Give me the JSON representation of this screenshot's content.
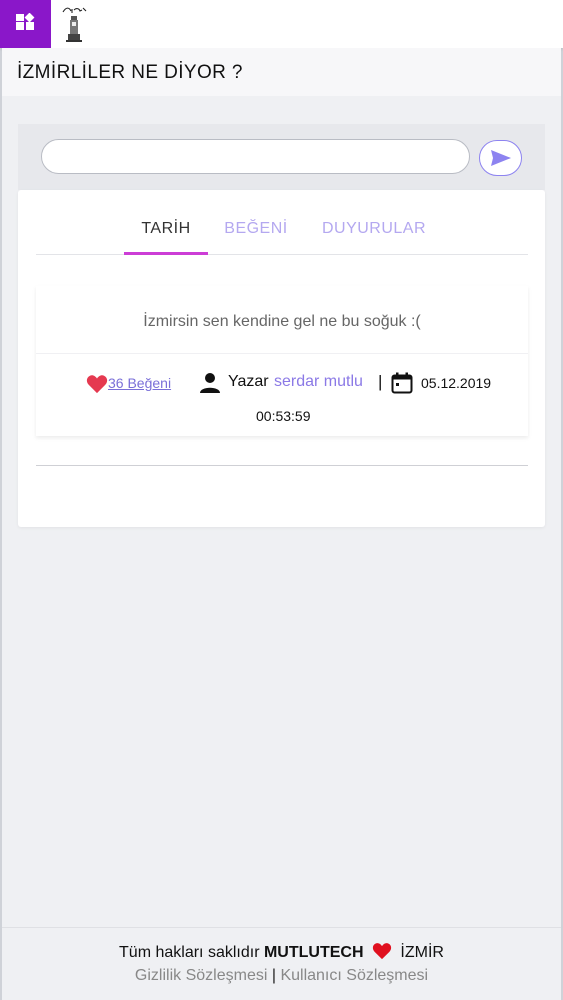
{
  "header": {
    "menu_icon": "apps-grid-icon",
    "logo_icon": "izmir-clock-tower-logo",
    "accent": "#8a17c9"
  },
  "page": {
    "title": "İZMİRLİLER NE DİYOR ?"
  },
  "search": {
    "value": "",
    "placeholder": "",
    "send_icon": "send-arrow-icon"
  },
  "tabs": [
    {
      "label": "TARİH",
      "active": true
    },
    {
      "label": "BEĞENİ",
      "active": false
    },
    {
      "label": "DUYURULAR",
      "active": false
    }
  ],
  "post": {
    "text": "İzmirsin sen kendine gel ne bu soğuk :(",
    "likes_label": " 36 Beğeni",
    "author_label": "Yazar",
    "author": "serdar mutlu",
    "separator": "|",
    "date": "05.12.2019",
    "time": "00:53:59"
  },
  "footer": {
    "rights": "Tüm hakları saklıdır",
    "brand": "MUTLUTECH",
    "city": "İZMİR",
    "privacy": "Gizlilik Sözleşmesi",
    "terms": "Kullanıcı Sözleşmesi",
    "separator": "|"
  },
  "colors": {
    "tab_indicator": "#cc3dd6",
    "link": "#8b79e6",
    "heart": "#e53950"
  }
}
